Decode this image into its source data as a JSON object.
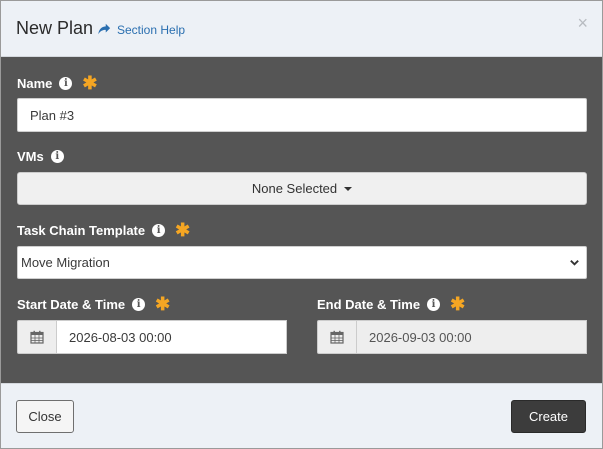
{
  "modal": {
    "title": "New Plan",
    "help_link": "Section Help",
    "close_glyph": "×"
  },
  "fields": {
    "name": {
      "label": "Name",
      "value": "Plan #3",
      "required": true
    },
    "vms": {
      "label": "VMs",
      "selected": "None Selected"
    },
    "task_chain_template": {
      "label": "Task Chain Template",
      "selected": "Move Migration",
      "required": true
    },
    "start_date": {
      "label": "Start Date & Time",
      "value": "2026-08-03 00:00",
      "required": true
    },
    "end_date": {
      "label": "End Date & Time",
      "value": "2026-09-03 00:00",
      "required": true,
      "disabled": true
    }
  },
  "footer": {
    "close_label": "Close",
    "create_label": "Create"
  },
  "icons": {
    "info": "info-circle-icon",
    "required": "asterisk-icon",
    "help": "share-arrow-icon",
    "calendar": "calendar-icon",
    "caret": "caret-down-icon",
    "chevron": "chevron-down-icon"
  },
  "colors": {
    "body_bg": "#555555",
    "header_bg": "#edf1f6",
    "required_star": "#f5a623",
    "link": "#2a6fb0",
    "create_button": "#3c3c3c"
  }
}
